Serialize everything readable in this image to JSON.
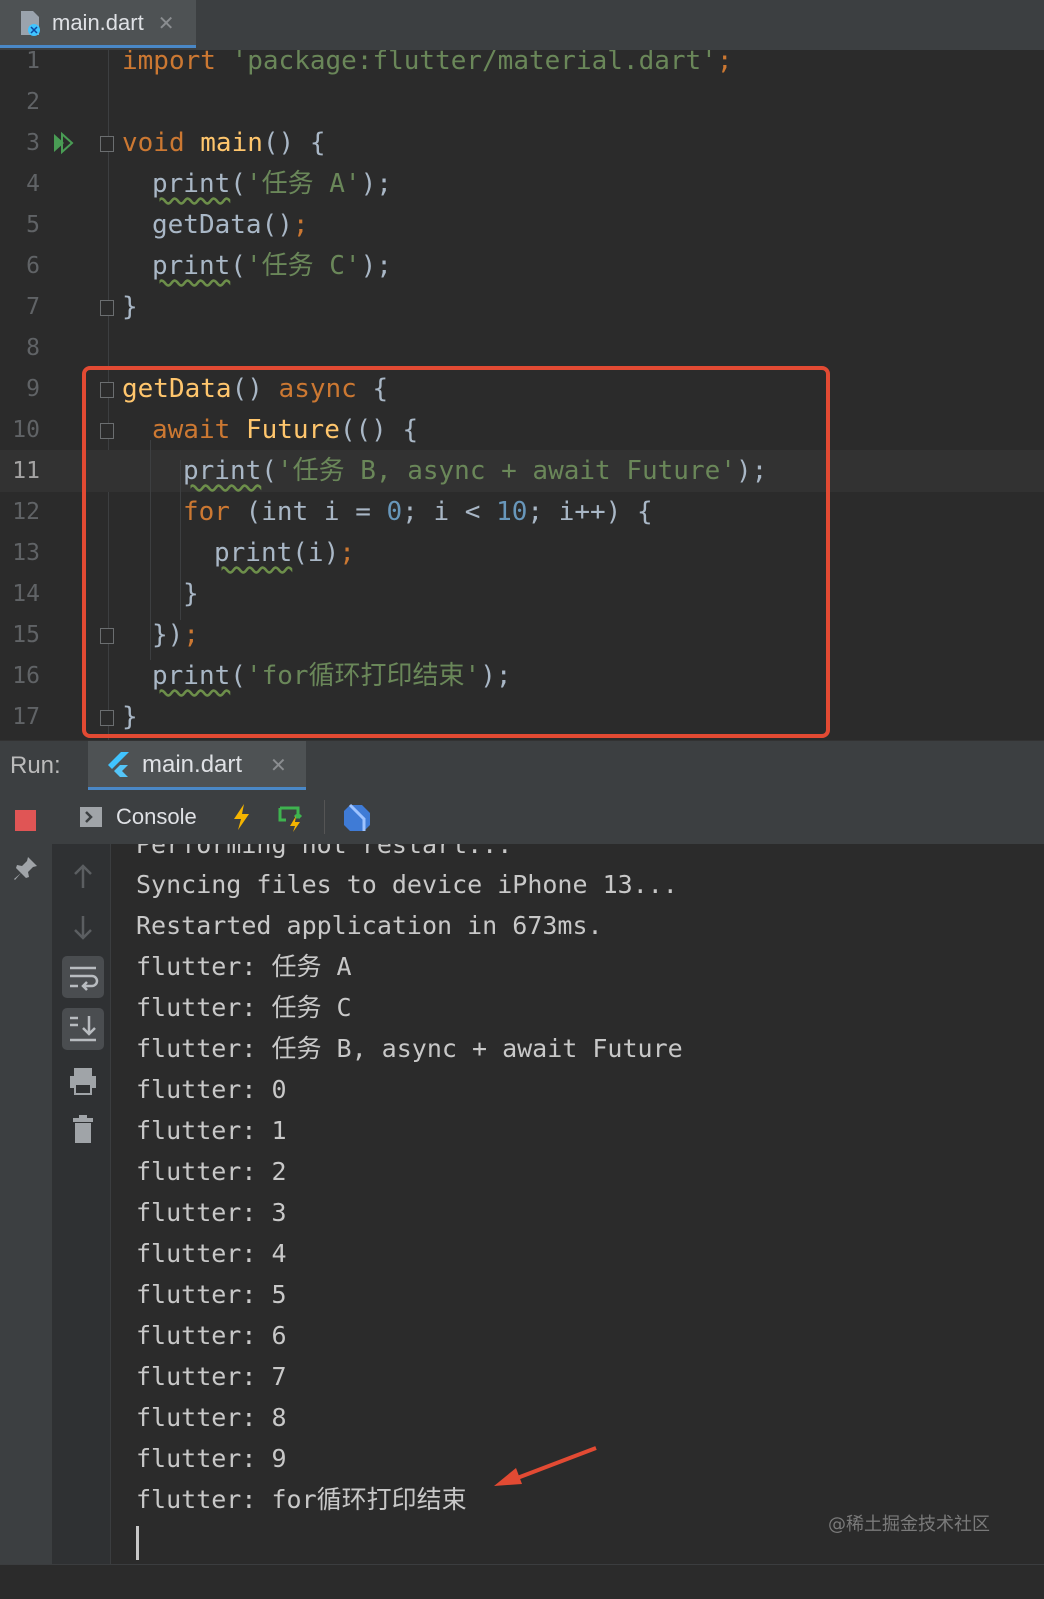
{
  "editor_tab": {
    "file": "main.dart",
    "close": "✕"
  },
  "code_lines": [
    {
      "no": "1"
    },
    {
      "no": "2"
    },
    {
      "no": "3"
    },
    {
      "no": "4"
    },
    {
      "no": "5"
    },
    {
      "no": "6"
    },
    {
      "no": "7"
    },
    {
      "no": "8"
    },
    {
      "no": "9"
    },
    {
      "no": "10"
    },
    {
      "no": "11"
    },
    {
      "no": "12"
    },
    {
      "no": "13"
    },
    {
      "no": "14"
    },
    {
      "no": "15"
    },
    {
      "no": "16"
    },
    {
      "no": "17"
    }
  ],
  "code": {
    "l1": {
      "kw": "import",
      "str": "'package:flutter/material.dart'",
      "end": ";"
    },
    "l3": {
      "kw": "void",
      "fn": "main",
      "rest": "() {"
    },
    "l4": {
      "call": "print",
      "open": "(",
      "str": "'任务 A'",
      "end": ");"
    },
    "l5": {
      "text": "getData()",
      "end": ";"
    },
    "l6": {
      "call": "print",
      "open": "(",
      "str": "'任务 C'",
      "end": ");"
    },
    "l7": {
      "text": "}"
    },
    "l9": {
      "fn": "getData",
      "rest": "() ",
      "kw": "async",
      "end": " {"
    },
    "l10": {
      "kw": "await",
      "fn": "Future",
      "rest": "(() {"
    },
    "l11": {
      "call": "print",
      "open": "(",
      "str": "'任务 B, async + await Future'",
      "end": ");"
    },
    "l12": {
      "kw": "for",
      "a": " (int i = ",
      "n1": "0",
      "b": "; i < ",
      "n2": "10",
      "c": "; i++) {"
    },
    "l13": {
      "call": "print",
      "rest": "(i)",
      "end": ";"
    },
    "l14": {
      "text": "}"
    },
    "l15": {
      "text": "})",
      "end": ";"
    },
    "l16": {
      "call": "print",
      "open": "(",
      "str": "'for循环打印结束'",
      "end": ");"
    },
    "l17": {
      "text": "}"
    }
  },
  "run_bar": {
    "label": "Run:",
    "tab": "main.dart",
    "close": "✕"
  },
  "console_toolbar": {
    "console_label": "Console"
  },
  "console_lines": [
    "Performing hot restart...",
    "Syncing files to device iPhone 13...",
    "Restarted application in 673ms.",
    "flutter: 任务 A",
    "flutter: 任务 C",
    "flutter: 任务 B, async + await Future",
    "flutter: 0",
    "flutter: 1",
    "flutter: 2",
    "flutter: 3",
    "flutter: 4",
    "flutter: 5",
    "flutter: 6",
    "flutter: 7",
    "flutter: 8",
    "flutter: 9",
    "flutter: for循环打印结束"
  ],
  "watermark": "@稀土掘金技术社区",
  "colors": {
    "keyword": "#cc7832",
    "function": "#ffc66d",
    "string": "#6a8759",
    "number": "#6897bb",
    "highlight": "#e24a33",
    "accent": "#4a88c7"
  },
  "icons": [
    "dart-file-icon",
    "run-arrow-icon",
    "flutter-icon",
    "stop-icon",
    "pin-icon",
    "console-icon",
    "hot-reload-icon",
    "hot-restart-icon",
    "dart-devtools-icon",
    "scroll-up-icon",
    "scroll-down-icon",
    "soft-wrap-icon",
    "scroll-to-end-icon",
    "print-icon",
    "trash-icon",
    "arrow-annotation-icon"
  ]
}
